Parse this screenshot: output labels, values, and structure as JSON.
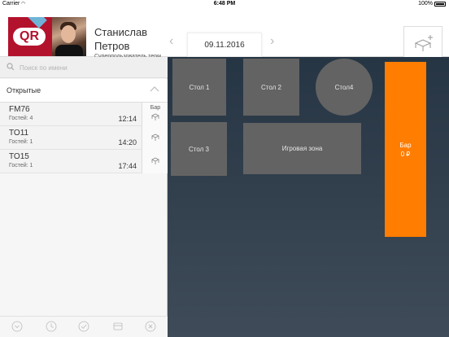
{
  "status_bar": {
    "carrier": "Carrier",
    "time": "6:48 PM",
    "battery": "100%"
  },
  "header": {
    "logo_text": "QR",
    "user_first_name": "Станислав",
    "user_last_name": "Петров",
    "user_role": "Суперпользователь терм...",
    "date": "09.11.2016",
    "prev_icon": "chevron-left-icon",
    "next_icon": "chevron-right-icon",
    "add_table_icon": "add-table-icon"
  },
  "sidebar": {
    "search_placeholder": "Поиск по имени",
    "section_title": "Открытые",
    "orders": [
      {
        "name": "FM76",
        "guests": "Гостей: 4",
        "time": "12:14",
        "tag": "Бар"
      },
      {
        "name": "TO11",
        "guests": "Гостей: 1",
        "time": "14:20",
        "tag": ""
      },
      {
        "name": "TO15",
        "guests": "Гостей: 1",
        "time": "17:44",
        "tag": ""
      }
    ],
    "bottom_icons": [
      "down-circle-icon",
      "clock-circle-icon",
      "check-circle-icon",
      "card-icon",
      "close-circle-icon"
    ]
  },
  "floor": {
    "tables": [
      {
        "label": "Стол 1"
      },
      {
        "label": "Стол 2"
      },
      {
        "label": "Стол4"
      },
      {
        "label": "Стол 3"
      },
      {
        "label": "Игровая зона"
      }
    ],
    "bar": {
      "label": "Бар",
      "amount": "0 ₽"
    }
  },
  "colors": {
    "accent": "#ff7d00",
    "floor_bg": "#2f3d4b",
    "table": "#636363",
    "logo_red": "#b3122d"
  }
}
